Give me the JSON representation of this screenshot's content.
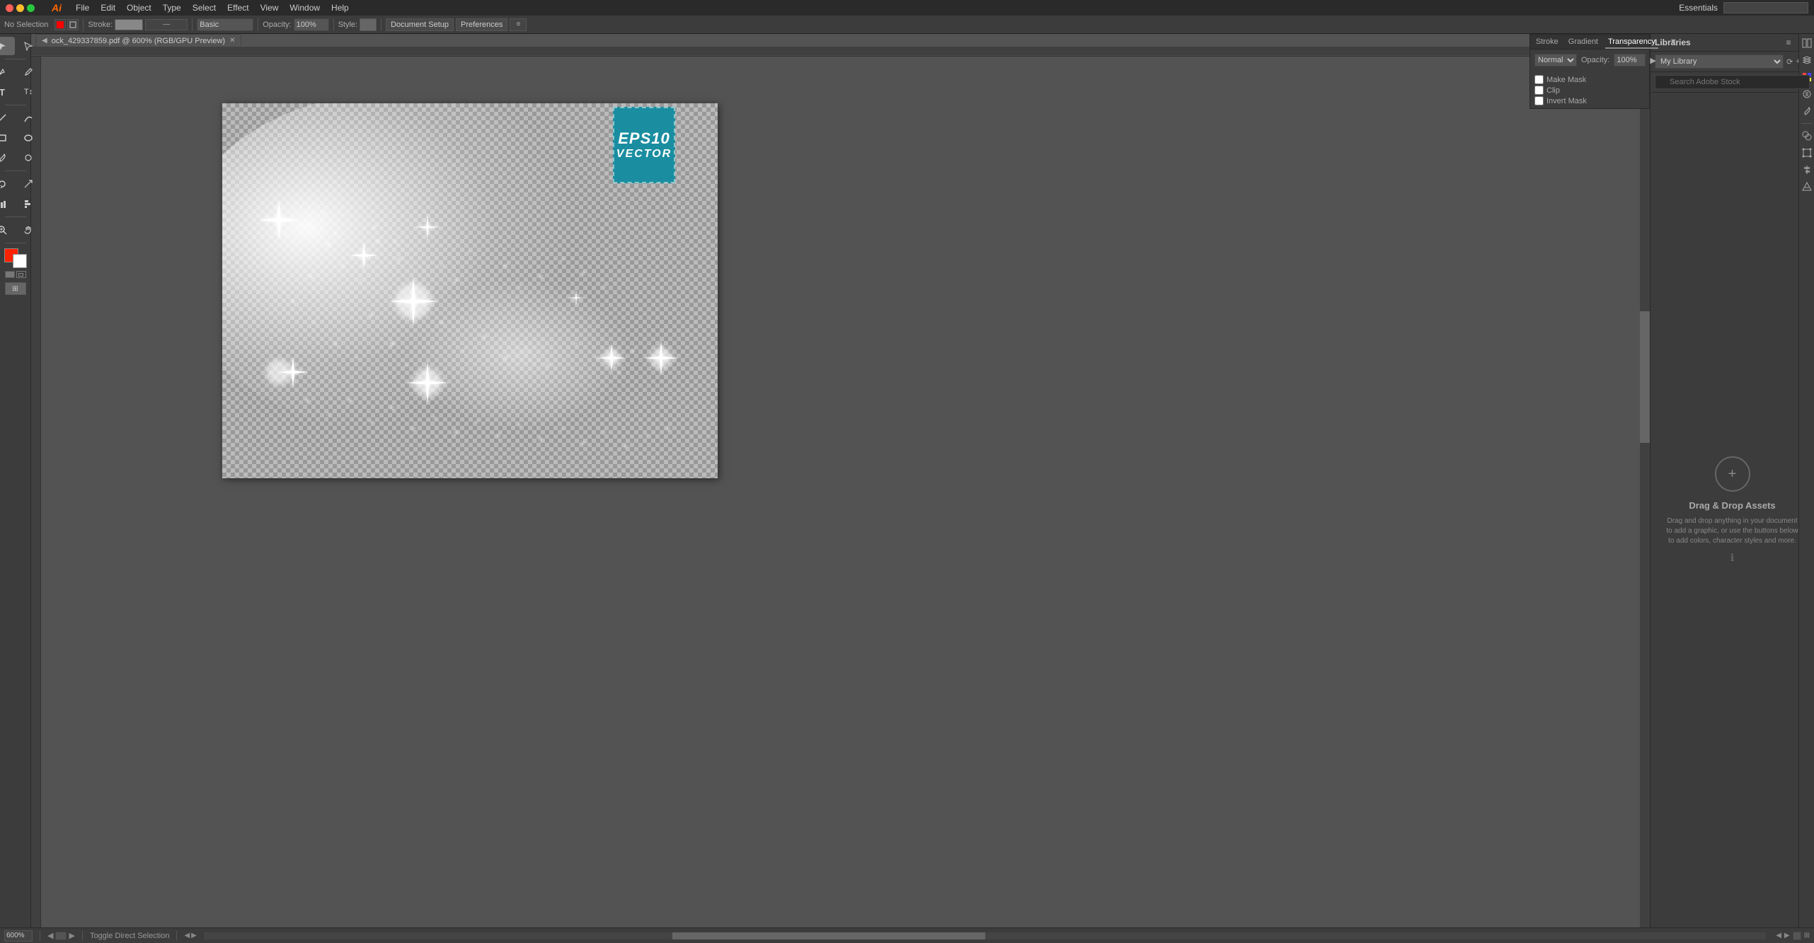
{
  "menubar": {
    "items": [
      "File",
      "Edit",
      "Object",
      "Type",
      "Select",
      "Effect",
      "View",
      "Window",
      "Help"
    ]
  },
  "toolbar": {
    "no_selection": "No Selection",
    "stroke_label": "Stroke:",
    "opacity_label": "Opacity:",
    "opacity_value": "100%",
    "style_label": "Style:",
    "stroke_preset": "Basic",
    "document_setup": "Document Setup",
    "preferences": "Preferences"
  },
  "doc_tab": {
    "title": "ock_429337859.pdf @ 600% (RGB/GPU Preview)"
  },
  "essentials": {
    "label": "Essentials",
    "search_placeholder": ""
  },
  "libraries": {
    "title": "Libraries",
    "library_name": "My Library",
    "search_placeholder": "Search Adobe Stock"
  },
  "sgt_panel": {
    "stroke_tab": "Stroke",
    "gradient_tab": "Gradient",
    "transparency_tab": "Transparency",
    "active_tab": "Transparency",
    "blend_label": "Normal",
    "opacity_label": "Opacity:",
    "opacity_value": "100%",
    "make_mask": "Make Mask",
    "clip": "Clip",
    "invert_mask": "Invert Mask"
  },
  "drag_drop": {
    "circle_icon": "+",
    "title": "Drag & Drop Assets",
    "description": "Drag and drop anything in your document to add a graphic, or use the buttons below to add colors, character styles and more.",
    "info_icon": "ℹ"
  },
  "status_bar": {
    "zoom": "600%",
    "artboard": "Toggle Direct Selection",
    "tool_label": "Toggle Direct Selection"
  },
  "eps_badge": {
    "eps_text": "EPS10",
    "vector_text": "VECTOR"
  }
}
